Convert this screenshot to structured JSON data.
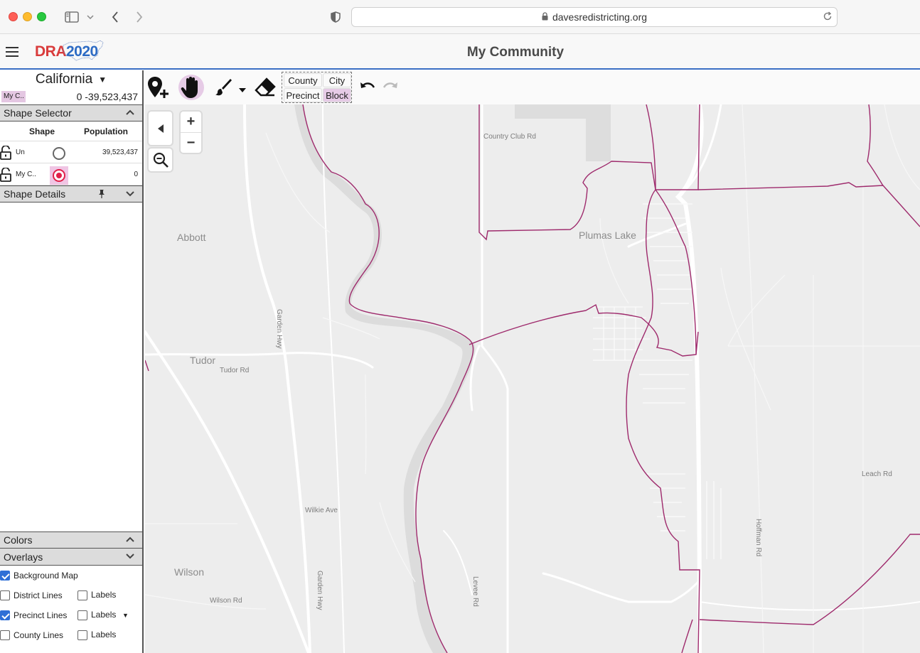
{
  "browser": {
    "url": "davesredistricting.org"
  },
  "app": {
    "logo_dra": "DRA",
    "logo_year": "2020",
    "title": "My Community"
  },
  "left_panel": {
    "state": "California",
    "plan_chip": "My C..",
    "plan_counts": "0  -39,523,437",
    "shape_selector": {
      "title": "Shape Selector",
      "col_shape": "Shape",
      "col_population": "Population",
      "rows": [
        {
          "name": "Un",
          "population": "39,523,437",
          "selected": false
        },
        {
          "name": "My C..",
          "population": "0",
          "selected": true
        }
      ]
    },
    "shape_details_title": "Shape Details",
    "colors_title": "Colors",
    "overlays_title": "Overlays",
    "overlays": [
      {
        "label": "Background Map",
        "checked": true
      },
      {
        "label": "District Lines",
        "checked": false,
        "labels_label": "Labels",
        "labels_checked": false
      },
      {
        "label": "Precinct Lines",
        "checked": true,
        "labels_label": "Labels",
        "labels_checked": false
      },
      {
        "label": "County Lines",
        "checked": false,
        "labels_label": "Labels",
        "labels_checked": false
      }
    ]
  },
  "toolbar": {
    "granularity": {
      "county": "County",
      "city": "City",
      "precinct": "Precinct",
      "block": "Block",
      "selected": "Block"
    }
  },
  "map": {
    "zoom_in": "+",
    "zoom_out": "−",
    "towns": [
      "Abbott",
      "Tudor",
      "Wilson",
      "Plumas Lake"
    ],
    "roads": [
      "Country Club Rd",
      "Tudor Rd",
      "Garden Hwy",
      "Wilkie Ave",
      "Wilson Rd",
      "Levee Rd",
      "Leach Rd",
      "Hoffman Rd"
    ],
    "precinct_line_color": "#9e2a6c"
  }
}
